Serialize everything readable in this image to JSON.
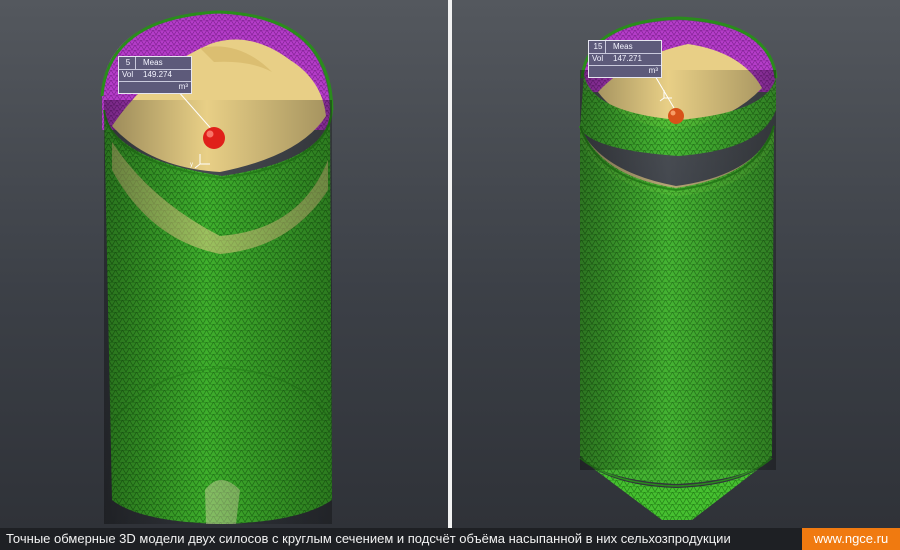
{
  "colors": {
    "mesh_green": "#3fb82a",
    "mesh_green_dark": "#2a8c1c",
    "mesh_magenta": "#b43cc8",
    "grain": "#e8cf86",
    "marker_red": "#e0201a",
    "caption_bg": "#1e2024",
    "badge_bg": "#f07a10"
  },
  "left_panel": {
    "measure": {
      "id": "5",
      "title": "Meas",
      "label": "Vol",
      "value": "149.274",
      "unit": "m³"
    },
    "marker": "red-sphere-icon",
    "axes": "xyz-axes-icon"
  },
  "right_panel": {
    "measure": {
      "id": "15",
      "title": "Meas",
      "label": "Vol",
      "value": "147.271",
      "unit": "m³"
    },
    "marker": "orange-sphere-icon",
    "axes": "xyz-axes-icon"
  },
  "caption": {
    "text": "Точные обмерные 3D модели двух силосов с круглым сечением и подсчёт объёма насыпанной в них сельхозпродукции",
    "site": "www.ngce.ru"
  }
}
